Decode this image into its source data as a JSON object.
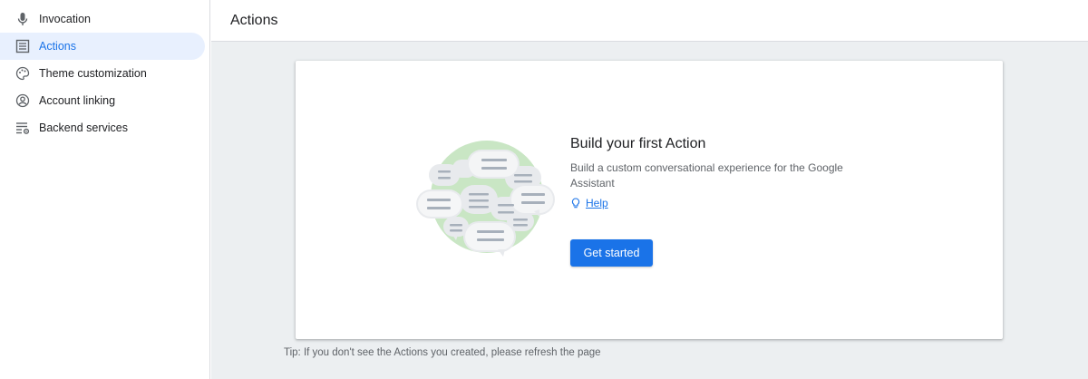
{
  "sidebar": {
    "items": [
      {
        "label": "Invocation",
        "icon": "microphone-icon",
        "active": false
      },
      {
        "label": "Actions",
        "icon": "list-document-icon",
        "active": true
      },
      {
        "label": "Theme customization",
        "icon": "palette-icon",
        "active": false
      },
      {
        "label": "Account linking",
        "icon": "account-circle-icon",
        "active": false
      },
      {
        "label": "Backend services",
        "icon": "settings-list-icon",
        "active": false
      }
    ]
  },
  "header": {
    "title": "Actions"
  },
  "card": {
    "title": "Build your first Action",
    "description": "Build a custom conversational experience for the Google Assistant",
    "help_label": "Help",
    "button_label": "Get started"
  },
  "tip": "Tip: If you don't see the Actions you created, please refresh the page",
  "colors": {
    "accent": "#1a73e8",
    "active_bg": "#e8f0fe",
    "main_bg": "#eceff1",
    "illustration_green": "#c9e6c4"
  }
}
